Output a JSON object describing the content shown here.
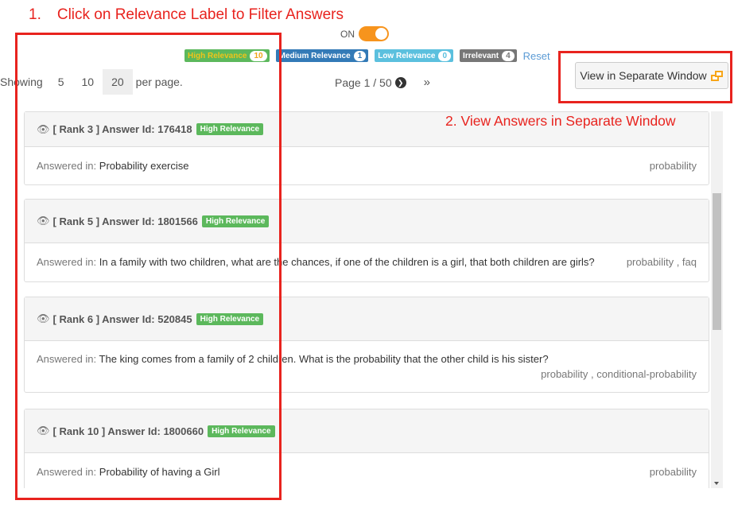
{
  "annotations": {
    "step1_number": "1.",
    "step1_text": "Click on Relevance Label to Filter Answers",
    "step2_text": "2. View Answers in Separate Window",
    "box_color": "#e8231e"
  },
  "toggle": {
    "label": "ON",
    "state": "on",
    "color": "#f7941d"
  },
  "filters": {
    "high": {
      "label": "High Relevance",
      "count": "10",
      "color": "#5cb85c"
    },
    "medium": {
      "label": "Medium Relevance",
      "count": "1",
      "color": "#337ab7"
    },
    "low": {
      "label": "Low Relevance",
      "count": "0",
      "color": "#5bc0de"
    },
    "irrelevant": {
      "label": "Irrelevant",
      "count": "4",
      "color": "#777777"
    },
    "reset_label": "Reset"
  },
  "page_size": {
    "label_before": "Showing",
    "options": [
      "5",
      "10",
      "20"
    ],
    "selected": "20",
    "label_after": "per page."
  },
  "pagination": {
    "text": "Page 1 / 50",
    "next_icon": "chevron-circle-right-icon",
    "last_icon": "double-chevron-right-icon",
    "last_glyph": "»"
  },
  "view_button": {
    "label": "View in Separate Window",
    "icon": "external-window-icon"
  },
  "answers": [
    {
      "header": "[ Rank 3 ] Answer Id: 176418",
      "badge": "High Relevance",
      "answered_in_label": "Answered in:",
      "question": "Probability exercise",
      "tags": "probability"
    },
    {
      "header": "[ Rank 5 ] Answer Id: 1801566",
      "badge": "High Relevance",
      "answered_in_label": "Answered in:",
      "question": "In a family with two children, what are the chances, if one of the children is a girl, that both children are girls?",
      "tags": "probability , faq"
    },
    {
      "header": "[ Rank 6 ] Answer Id: 520845",
      "badge": "High Relevance",
      "answered_in_label": "Answered in:",
      "question": "The king comes from a family of 2 children. What is the probability that the other child is his sister?",
      "tags": "probability , conditional-probability"
    },
    {
      "header": "[ Rank 10 ] Answer Id: 1800660",
      "badge": "High Relevance",
      "answered_in_label": "Answered in:",
      "question": "Probability of having a Girl",
      "tags": "probability"
    }
  ]
}
